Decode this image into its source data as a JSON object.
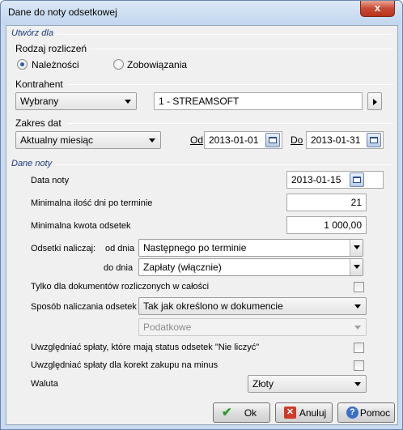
{
  "window": {
    "title": "Dane do noty odsetkowej",
    "close_glyph": "x"
  },
  "utworz": {
    "section_title": "Utwórz dla",
    "rodzaj": {
      "label": "Rodzaj rozliczeń",
      "option_1": "Należności",
      "option_2": "Zobowiązania",
      "selected": "Należności"
    },
    "kontrahent": {
      "label": "Kontrahent",
      "combo_value": "Wybrany",
      "field_value": "1 - STREAMSOFT"
    },
    "zakres": {
      "label": "Zakres dat",
      "combo_value": "Aktualny miesiąc",
      "od_label": "Od",
      "od_value": "2013-01-01",
      "do_label": "Do",
      "do_value": "2013-01-31"
    }
  },
  "dane": {
    "section_title": "Dane noty",
    "data_noty_label": "Data noty",
    "data_noty_value": "2013-01-15",
    "min_dni_label": "Minimalna ilość dni po terminie",
    "min_dni_value": "21",
    "min_kwota_label": "Minimalna kwota odsetek",
    "min_kwota_value": "1 000,00",
    "odsetki_label": "Odsetki naliczaj:",
    "od_dnia_label": "od dnia",
    "od_dnia_value": "Następnego po terminie",
    "do_dnia_label": "do dnia",
    "do_dnia_value": "Zapłaty (włącznie)",
    "tylko_label": "Tylko dla dokumentów rozliczonych w całości",
    "tylko_checked": false,
    "sposob_label": "Sposób naliczania odsetek",
    "sposob_value": "Tak jak określono w dokumencie",
    "podatkowe_value": "Podatkowe",
    "uwzgl_splaty_label": "Uwzględniać spłaty, które mają status odsetek \"Nie liczyć\"",
    "uwzgl_splaty_checked": false,
    "uwzgl_korekt_label": "Uwzględniać spłaty dla korekt zakupu na minus",
    "uwzgl_korekt_checked": false,
    "waluta_label": "Waluta",
    "waluta_value": "Złoty"
  },
  "buttons": {
    "ok_label": "Ok",
    "anuluj_label": "Anuluj",
    "pomoc_label": "Pomoc"
  },
  "icons": {
    "ok": "check-icon",
    "anuluj": "cancel-x-icon",
    "pomoc": "help-question-icon",
    "calendar": "calendar-icon"
  }
}
